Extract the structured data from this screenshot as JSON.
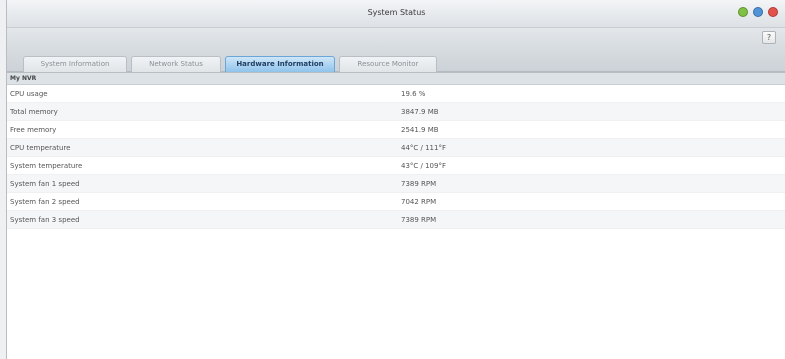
{
  "window": {
    "title": "System Status",
    "controls": [
      {
        "name": "minimize-control",
        "color": "#7ec242"
      },
      {
        "name": "maximize-control",
        "color": "#4f93d9"
      },
      {
        "name": "close-control",
        "color": "#e4534b"
      }
    ],
    "help_label": "?"
  },
  "tabs": [
    {
      "label": "System Information",
      "active": false
    },
    {
      "label": "Network Status",
      "active": false
    },
    {
      "label": "Hardware Information",
      "active": true
    },
    {
      "label": "Resource Monitor",
      "active": false
    }
  ],
  "group": {
    "title": "My NVR"
  },
  "rows": [
    {
      "label": "CPU usage",
      "value": "19.6 %"
    },
    {
      "label": "Total memory",
      "value": "3847.9 MB"
    },
    {
      "label": "Free memory",
      "value": "2541.9 MB"
    },
    {
      "label": "CPU temperature",
      "value": "44°C / 111°F"
    },
    {
      "label": "System temperature",
      "value": "43°C / 109°F"
    },
    {
      "label": "System fan 1 speed",
      "value": "7389 RPM"
    },
    {
      "label": "System fan 2 speed",
      "value": "7042 RPM"
    },
    {
      "label": "System fan 3 speed",
      "value": "7389 RPM"
    }
  ]
}
